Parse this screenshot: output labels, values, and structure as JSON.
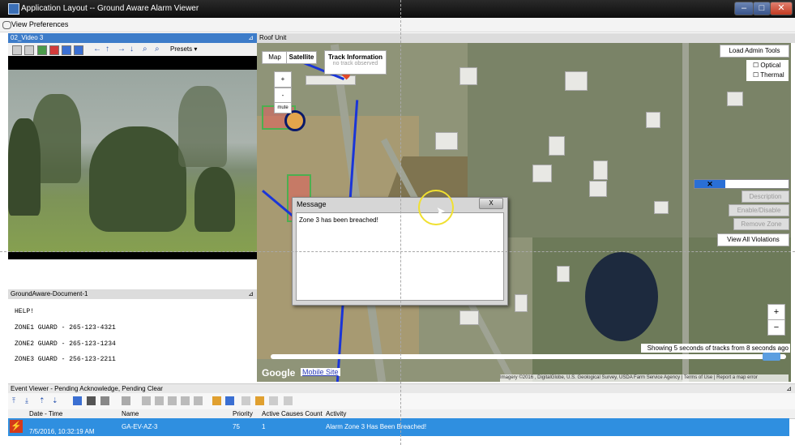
{
  "window": {
    "title": "Application Layout -- Ground Aware Alarm Viewer"
  },
  "menu": {
    "view_preferences": "View Preferences"
  },
  "video_pane": {
    "title": "02_Video 3",
    "presets_label": "Presets"
  },
  "document_pane": {
    "title": "GroundAware-Document-1",
    "lines": [
      "HELP!",
      "ZONE1 GUARD - 265-123-4321",
      "ZONE2 GUARD - 265-123-1234",
      "ZONE3 GUARD - 256-123-2211"
    ]
  },
  "map_pane": {
    "title": "Roof Unit",
    "map_tab": "Map",
    "satellite_tab": "Satellite",
    "track_info_title": "Track Information",
    "track_info_status": "no track observed",
    "zoom_in": "+",
    "zoom_out": "-",
    "mute": "mute",
    "load_admin_tools": "Load Admin Tools",
    "optical": "Optical",
    "thermal": "Thermal",
    "description_btn": "Description",
    "enable_disable_btn": "Enable/Disable",
    "remove_zone_btn": "Remove Zone",
    "view_all_violations": "View All Violations",
    "track_info_bar": "Showing 5 seconds of tracks from 8 seconds ago",
    "google": "Google",
    "mobile_site": "Mobile Site",
    "attribution": "Imagery ©2016 , DigitalGlobe, U.S. Geological Survey, USDA Farm Service Agency",
    "terms": "Terms of Use",
    "report": "Report a map error",
    "map_zoom_in": "+",
    "map_zoom_out": "−"
  },
  "dialog": {
    "title": "Message",
    "close": "X",
    "message": "Zone 3 has been breached!"
  },
  "event_viewer": {
    "title": "Event Viewer - Pending Acknowledge, Pending Clear",
    "columns": [
      "Date - Time",
      "Name",
      "Priority",
      "Active Causes Count",
      "Activity"
    ],
    "rows": [
      {
        "datetime": "7/5/2016, 10:32:19 AM",
        "name": "GA-EV-AZ-3",
        "priority": "75",
        "active_causes": "1",
        "activity": "Alarm Zone 3 Has Been Breached!"
      }
    ]
  },
  "colors": {
    "accent": "#3d7cc9",
    "selected_row": "#2f8fe0",
    "zone_outline": "#4caf50",
    "track_line": "#1a35d8"
  }
}
